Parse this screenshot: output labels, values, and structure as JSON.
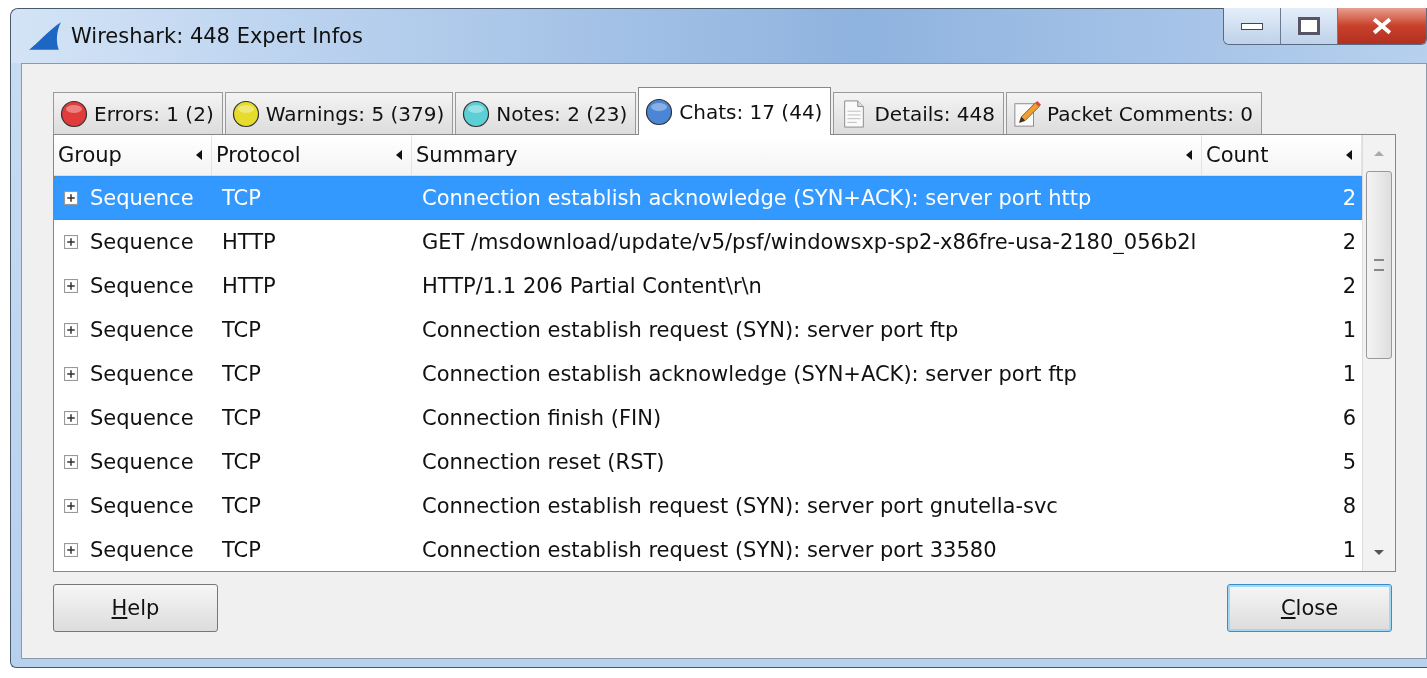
{
  "window": {
    "title": "Wireshark: 448 Expert Infos"
  },
  "tabs": [
    {
      "label": "Errors: 1 (2)",
      "kind": "dot",
      "color": "#e23b3b",
      "selected": false
    },
    {
      "label": "Warnings: 5 (379)",
      "kind": "dot",
      "color": "#e6dc2c",
      "selected": false
    },
    {
      "label": "Notes: 2 (23)",
      "kind": "dot",
      "color": "#5ccfd6",
      "selected": false
    },
    {
      "label": "Chats: 17 (44)",
      "kind": "dot",
      "color": "#4a85d6",
      "selected": true
    },
    {
      "label": "Details: 448",
      "kind": "document",
      "selected": false
    },
    {
      "label": "Packet Comments: 0",
      "kind": "pencil",
      "selected": false
    }
  ],
  "table": {
    "columns": [
      "Group",
      "Protocol",
      "Summary",
      "Count"
    ],
    "rows": [
      {
        "group": "Sequence",
        "protocol": "TCP",
        "summary": "Connection establish acknowledge (SYN+ACK): server port http",
        "count": "2",
        "expanded": false,
        "selected": true
      },
      {
        "group": "Sequence",
        "protocol": "HTTP",
        "summary": "GET /msdownload/update/v5/psf/windowsxp-sp2-x86fre-usa-2180_056b2l",
        "count": "2",
        "expanded": false,
        "selected": false
      },
      {
        "group": "Sequence",
        "protocol": "HTTP",
        "summary": "HTTP/1.1 206 Partial Content\\r\\n",
        "count": "2",
        "expanded": false,
        "selected": false
      },
      {
        "group": "Sequence",
        "protocol": "TCP",
        "summary": "Connection establish request (SYN): server port ftp",
        "count": "1",
        "expanded": false,
        "selected": false
      },
      {
        "group": "Sequence",
        "protocol": "TCP",
        "summary": "Connection establish acknowledge (SYN+ACK): server port ftp",
        "count": "1",
        "expanded": false,
        "selected": false
      },
      {
        "group": "Sequence",
        "protocol": "TCP",
        "summary": "Connection finish (FIN)",
        "count": "6",
        "expanded": false,
        "selected": false
      },
      {
        "group": "Sequence",
        "protocol": "TCP",
        "summary": "Connection reset (RST)",
        "count": "5",
        "expanded": false,
        "selected": false
      },
      {
        "group": "Sequence",
        "protocol": "TCP",
        "summary": "Connection establish request (SYN): server port gnutella-svc",
        "count": "8",
        "expanded": false,
        "selected": false
      },
      {
        "group": "Sequence",
        "protocol": "TCP",
        "summary": "Connection establish request (SYN): server port 33580",
        "count": "1",
        "expanded": false,
        "selected": false
      }
    ]
  },
  "buttons": [
    {
      "mnemonic": "H",
      "rest": "elp",
      "default": false
    },
    {
      "mnemonic": "C",
      "rest": "lose",
      "default": true
    }
  ]
}
